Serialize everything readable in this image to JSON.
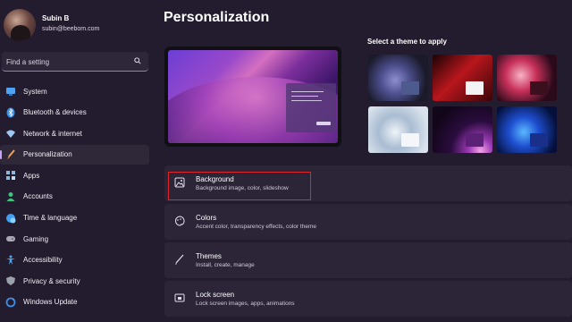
{
  "profile": {
    "name": "Subin B",
    "email": "subin@beebom.com"
  },
  "search": {
    "placeholder": "Find a setting"
  },
  "sidebar": {
    "items": [
      {
        "label": "System",
        "icon": "monitor-icon",
        "color": "#4ea3f5"
      },
      {
        "label": "Bluetooth & devices",
        "icon": "bluetooth-icon",
        "color": "#3b8fe8"
      },
      {
        "label": "Network & internet",
        "icon": "wifi-icon",
        "color": "#9cc8f2"
      },
      {
        "label": "Personalization",
        "icon": "brush-icon",
        "color": "#f0a060",
        "active": true
      },
      {
        "label": "Apps",
        "icon": "apps-icon",
        "color": "#8fb6d9"
      },
      {
        "label": "Accounts",
        "icon": "person-icon",
        "color": "#3ec37d"
      },
      {
        "label": "Time & language",
        "icon": "globe-clock-icon",
        "color": "#3f9ff0"
      },
      {
        "label": "Gaming",
        "icon": "gamepad-icon",
        "color": "#a9a9b4"
      },
      {
        "label": "Accessibility",
        "icon": "accessibility-icon",
        "color": "#4aa8f0"
      },
      {
        "label": "Privacy & security",
        "icon": "shield-icon",
        "color": "#9aa3ad"
      },
      {
        "label": "Windows Update",
        "icon": "update-icon",
        "color": "#3b8fe8"
      }
    ]
  },
  "main": {
    "title": "Personalization",
    "theme_heading": "Select a theme to apply",
    "themes": [
      {
        "name": "windows-bloom-dark-theme",
        "bg": "#3c3f66",
        "accent": "#3a4f8a"
      },
      {
        "name": "glow-red-theme",
        "bg": "#6a0f16",
        "accent": "#e43b3b"
      },
      {
        "name": "flower-theme",
        "bg": "#3a1024",
        "accent": "#c22a3d"
      },
      {
        "name": "windows-bloom-light-theme",
        "bg": "#c6d3e2",
        "accent": "#b7c2cf"
      },
      {
        "name": "captured-motion-theme",
        "bg": "#2a0f3d",
        "accent": "#6a2b8a"
      },
      {
        "name": "windows-bloom-blue-theme",
        "bg": "#0a1e6a",
        "accent": "#2c5fd8"
      }
    ],
    "settings": [
      {
        "title": "Background",
        "subtitle": "Background image, color, slideshow",
        "icon": "image-icon",
        "highlighted": true
      },
      {
        "title": "Colors",
        "subtitle": "Accent color, transparency effects, color theme",
        "icon": "palette-icon"
      },
      {
        "title": "Themes",
        "subtitle": "Install, create, manage",
        "icon": "pen-icon"
      },
      {
        "title": "Lock screen",
        "subtitle": "Lock screen images, apps, animations",
        "icon": "lock-screen-icon"
      }
    ]
  },
  "colors": {
    "accent": "#c7a3ff",
    "highlight": "#e0252a",
    "window_bg": "#231c2e",
    "card_bg": "#2b2537"
  }
}
